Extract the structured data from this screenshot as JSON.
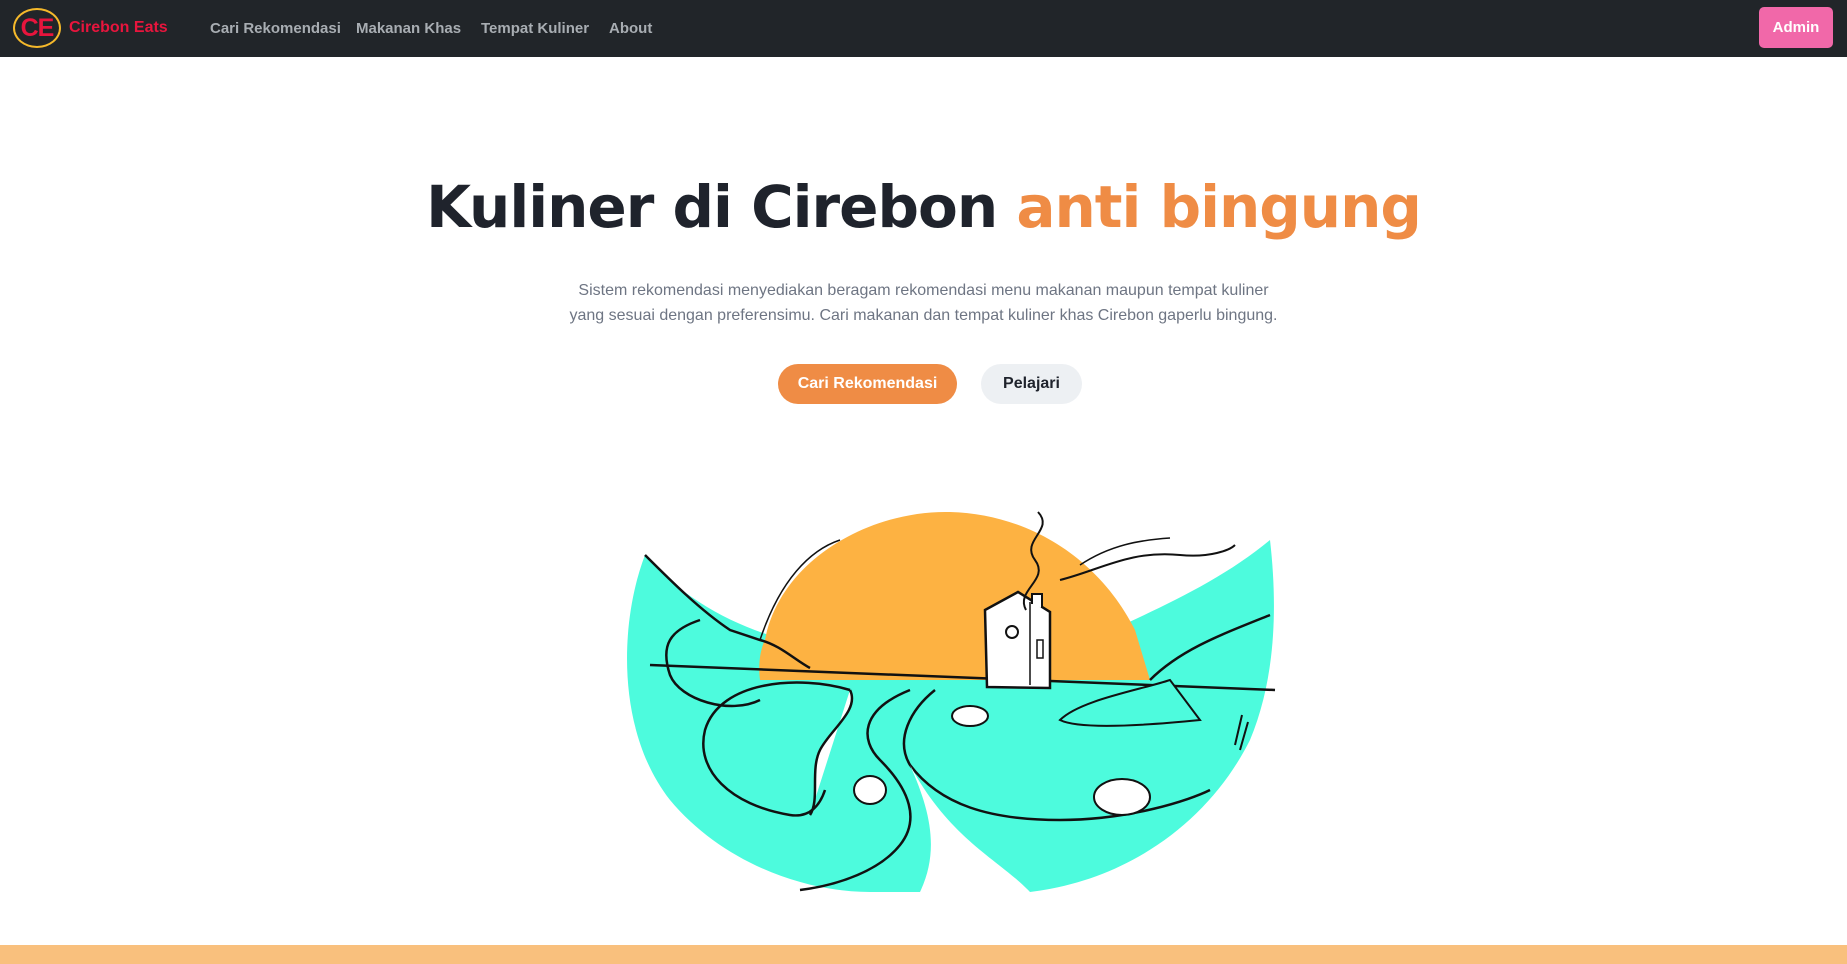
{
  "nav": {
    "logo_text": "CE",
    "brand": "Cirebon Eats",
    "links": [
      "Cari Rekomendasi",
      "Makanan Khas",
      "Tempat Kuliner",
      "About"
    ],
    "admin_label": "Admin"
  },
  "hero": {
    "title_main": "Kuliner di Cirebon ",
    "title_accent": "anti bingung",
    "description": "Sistem rekomendasi menyediakan beragam rekomendasi menu makanan maupun tempat kuliner yang sesuai dengan preferensimu. Cari makanan dan tempat kuliner khas Cirebon gaperlu bingung.",
    "primary_cta": "Cari Rekomendasi",
    "secondary_cta": "Pelajari"
  },
  "illustration": {
    "icon": "landscape-illustration",
    "colors": {
      "sun": "#fdb242",
      "water": "#4dfbdd",
      "outline": "#111111"
    }
  },
  "colors": {
    "navbar": "#212529",
    "brand": "#e8153d",
    "logo_ring": "#f5b92b",
    "admin_button": "#f168a9",
    "accent": "#ef8c45",
    "secondary_button": "#edf0f3",
    "bottom_band": "#f9c07d"
  }
}
